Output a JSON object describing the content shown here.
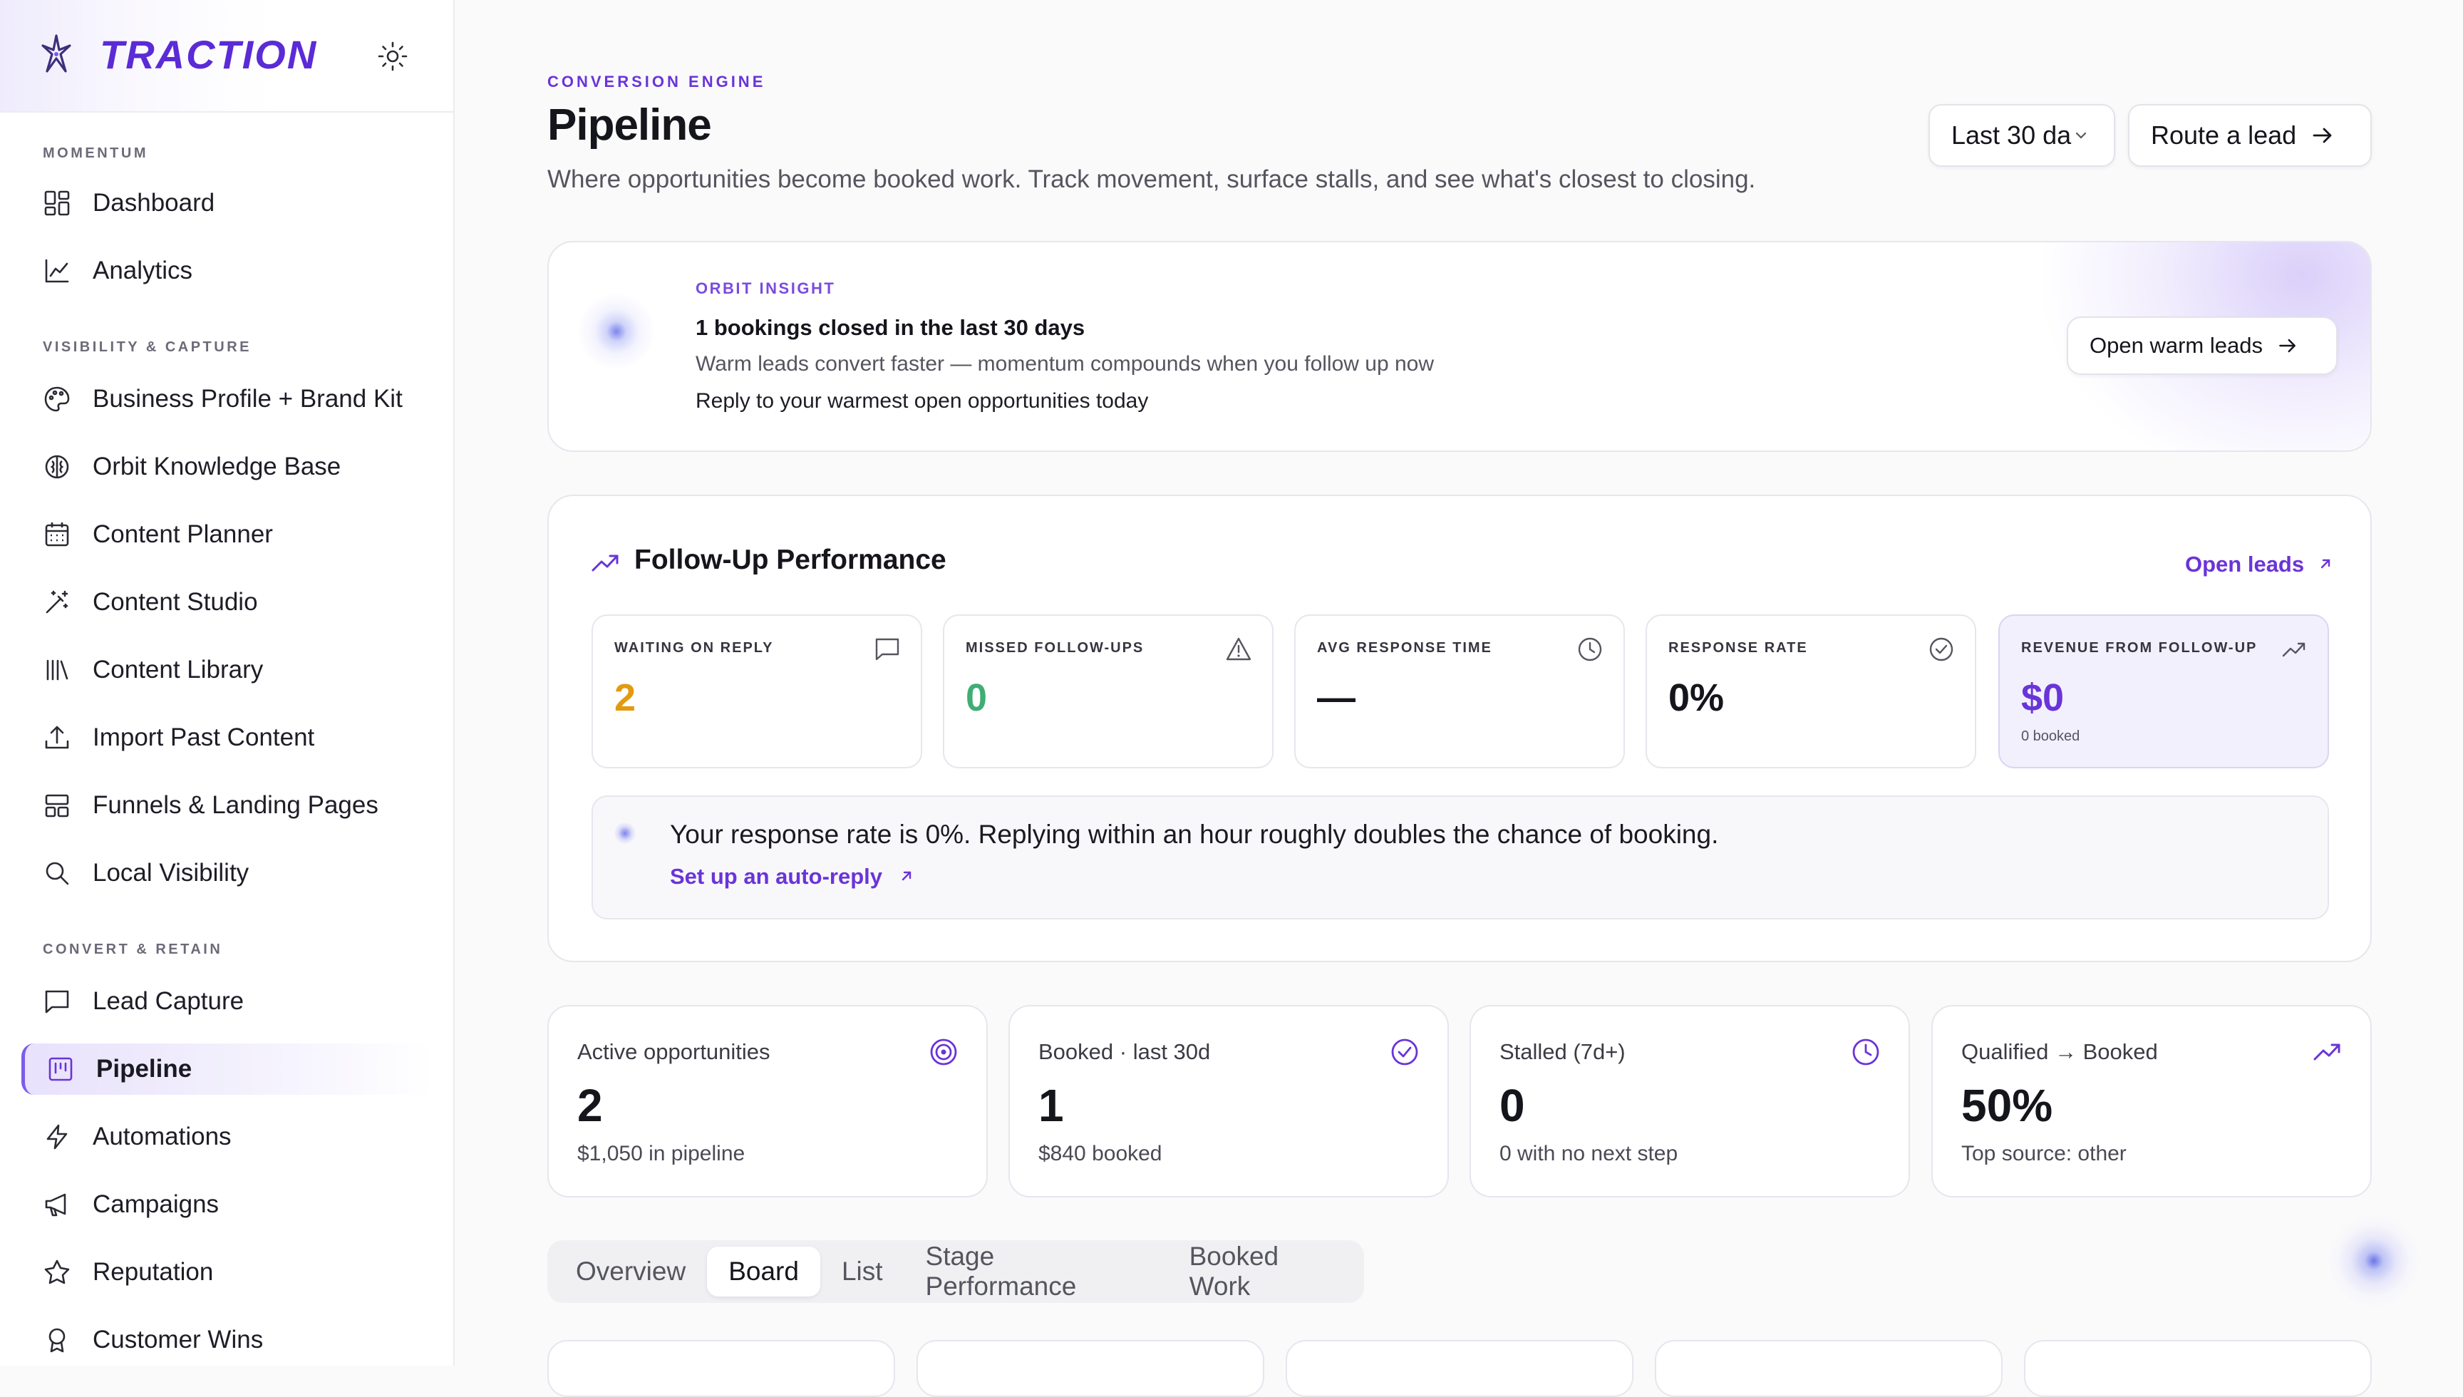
{
  "brand": {
    "name": "TRACTION"
  },
  "sidebar": {
    "sections": [
      {
        "title": "MOMENTUM",
        "items": [
          {
            "label": "Dashboard",
            "icon": "dashboard-icon"
          },
          {
            "label": "Analytics",
            "icon": "line-chart-icon"
          }
        ]
      },
      {
        "title": "VISIBILITY & CAPTURE",
        "items": [
          {
            "label": "Business Profile + Brand Kit",
            "icon": "palette-icon"
          },
          {
            "label": "Orbit Knowledge Base",
            "icon": "brain-icon"
          },
          {
            "label": "Content Planner",
            "icon": "calendar-icon"
          },
          {
            "label": "Content Studio",
            "icon": "magic-wand-icon"
          },
          {
            "label": "Content Library",
            "icon": "library-icon"
          },
          {
            "label": "Import Past Content",
            "icon": "upload-icon"
          },
          {
            "label": "Funnels & Landing Pages",
            "icon": "layout-icon"
          },
          {
            "label": "Local Visibility",
            "icon": "search-icon"
          }
        ]
      },
      {
        "title": "CONVERT & RETAIN",
        "items": [
          {
            "label": "Lead Capture",
            "icon": "message-icon"
          },
          {
            "label": "Pipeline",
            "icon": "kanban-icon",
            "active": true
          },
          {
            "label": "Automations",
            "icon": "lightning-icon"
          },
          {
            "label": "Campaigns",
            "icon": "megaphone-icon"
          },
          {
            "label": "Reputation",
            "icon": "star-icon"
          },
          {
            "label": "Customer Wins",
            "icon": "award-icon"
          }
        ]
      }
    ]
  },
  "header": {
    "eyebrow": "CONVERSION ENGINE",
    "title": "Pipeline",
    "subtitle": "Where opportunities become booked work. Track movement, surface stalls, and see what's closest to closing.",
    "range_select": "Last 30 da",
    "route_button": "Route a lead"
  },
  "insight": {
    "eyebrow": "ORBIT INSIGHT",
    "title": "1 bookings closed in the last 30 days",
    "description": "Warm leads convert faster — momentum compounds when you follow up now",
    "cta_text": "Reply to your warmest open opportunities today",
    "button": "Open warm leads"
  },
  "follow_up": {
    "title": "Follow-Up Performance",
    "open_leads": "Open leads",
    "stats": [
      {
        "label": "WAITING ON REPLY",
        "value": "2",
        "color": "#e39a0f",
        "icon": "message-square-icon"
      },
      {
        "label": "MISSED FOLLOW-UPS",
        "value": "0",
        "color": "#3fae74",
        "icon": "alert-triangle-icon"
      },
      {
        "label": "AVG RESPONSE TIME",
        "value": "—",
        "color": "#15151c",
        "icon": "clock-icon"
      },
      {
        "label": "RESPONSE RATE",
        "value": "0%",
        "color": "#15151c",
        "icon": "check-circle-icon"
      },
      {
        "label": "REVENUE FROM FOLLOW-UP",
        "value": "$0",
        "sub": "0 booked",
        "color": "#6a34d8",
        "icon": "trending-up-icon"
      }
    ],
    "tip_text": "Your response rate is 0%. Replying within an hour roughly doubles the chance of booking.",
    "tip_link": "Set up an auto-reply"
  },
  "kpis": [
    {
      "label": "Active opportunities",
      "value": "2",
      "sub": "$1,050 in pipeline",
      "icon": "target-icon"
    },
    {
      "label": "Booked · last 30d",
      "value": "1",
      "sub": "$840 booked",
      "icon": "check-circle-icon"
    },
    {
      "label": "Stalled (7d+)",
      "value": "0",
      "sub": "0 with no next step",
      "icon": "clock-icon"
    },
    {
      "label": "Qualified → Booked",
      "value": "50%",
      "sub": "Top source: other",
      "icon": "trending-up-icon"
    }
  ],
  "tabs": [
    {
      "label": "Overview"
    },
    {
      "label": "Board",
      "active": true
    },
    {
      "label": "List"
    },
    {
      "label": "Stage Performance"
    },
    {
      "label": "Booked Work"
    }
  ],
  "colors": {
    "accent": "#6a34d8",
    "brand": "#5b2bd6",
    "amber": "#e39a0f",
    "green": "#3fae74"
  }
}
